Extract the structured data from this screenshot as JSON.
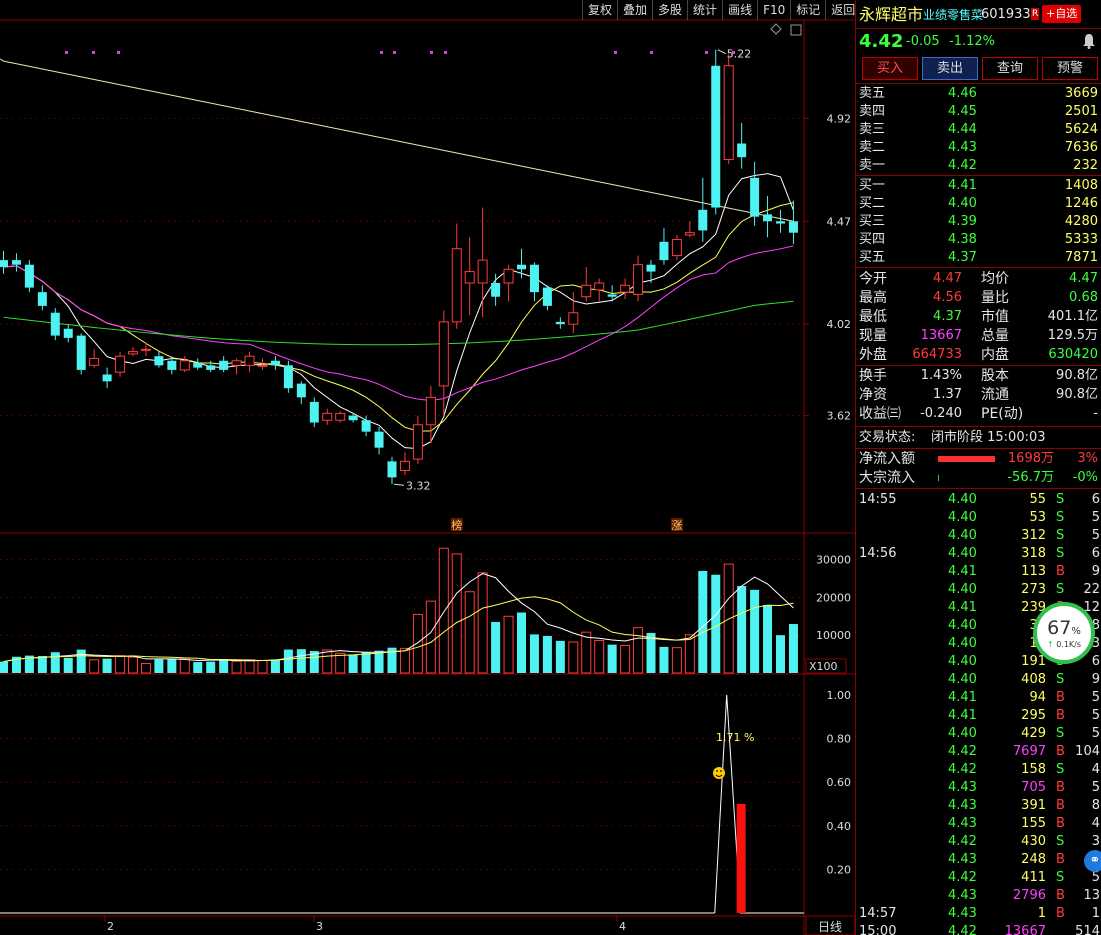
{
  "toolbar": [
    "复权",
    "叠加",
    "多股",
    "统计",
    "画线",
    "F10",
    "标记",
    "返回"
  ],
  "stock": {
    "name": "永辉超市",
    "sector": "业绩零售菜",
    "code": "601933",
    "r_badge": "R",
    "watch_button": "+自选",
    "price": "4.42",
    "change": "-0.05",
    "change_pct": "-1.12%"
  },
  "actions": [
    "买入",
    "卖出",
    "查询",
    "预警"
  ],
  "asks": [
    {
      "label": "卖五",
      "price": "4.46",
      "vol": "3669"
    },
    {
      "label": "卖四",
      "price": "4.45",
      "vol": "2501"
    },
    {
      "label": "卖三",
      "price": "4.44",
      "vol": "5624"
    },
    {
      "label": "卖二",
      "price": "4.43",
      "vol": "7636"
    },
    {
      "label": "卖一",
      "price": "4.42",
      "vol": "232"
    }
  ],
  "bids": [
    {
      "label": "买一",
      "price": "4.41",
      "vol": "1408"
    },
    {
      "label": "买二",
      "price": "4.40",
      "vol": "1246"
    },
    {
      "label": "买三",
      "price": "4.39",
      "vol": "4280"
    },
    {
      "label": "买四",
      "price": "4.38",
      "vol": "5333"
    },
    {
      "label": "买五",
      "price": "4.37",
      "vol": "7871"
    }
  ],
  "stats": [
    {
      "l1": "今开",
      "v1": "4.47",
      "c1": "red",
      "l2": "均价",
      "v2": "4.47",
      "c2": "green"
    },
    {
      "l1": "最高",
      "v1": "4.56",
      "c1": "red",
      "l2": "量比",
      "v2": "0.68",
      "c2": "green"
    },
    {
      "l1": "最低",
      "v1": "4.37",
      "c1": "green",
      "l2": "市值",
      "v2": "401.1亿",
      "c2": "white"
    },
    {
      "l1": "现量",
      "v1": "13667",
      "c1": "magenta",
      "l2": "总量",
      "v2": "129.5万",
      "c2": "white"
    },
    {
      "l1": "外盘",
      "v1": "664733",
      "c1": "red",
      "l2": "内盘",
      "v2": "630420",
      "c2": "green"
    }
  ],
  "stats2": [
    {
      "l1": "换手",
      "v1": "1.43%",
      "l2": "股本",
      "v2": "90.8亿"
    },
    {
      "l1": "净资",
      "v1": "1.37",
      "l2": "流通",
      "v2": "90.8亿"
    },
    {
      "l1": "收益㈢",
      "v1": "-0.240",
      "l2": "PE(动)",
      "v2": "-"
    }
  ],
  "status": {
    "label": "交易状态:",
    "value": "闭市阶段 15:00:03"
  },
  "flows": [
    {
      "label": "净流入额",
      "value": "1698万",
      "pct": "3%",
      "color": "red",
      "bar": 0.6
    },
    {
      "label": "大宗流入",
      "value": "-56.7万",
      "pct": "-0%",
      "color": "green",
      "bar": 0.0
    }
  ],
  "ticks": [
    {
      "time": "14:55",
      "price": "4.40",
      "vol": "55",
      "bs": "S",
      "n": "6",
      "vc": "white"
    },
    {
      "time": "",
      "price": "4.40",
      "vol": "53",
      "bs": "S",
      "n": "5",
      "vc": "white"
    },
    {
      "time": "",
      "price": "4.40",
      "vol": "312",
      "bs": "S",
      "n": "5",
      "vc": "white"
    },
    {
      "time": "14:56",
      "price": "4.40",
      "vol": "318",
      "bs": "S",
      "n": "6",
      "vc": "white"
    },
    {
      "time": "",
      "price": "4.41",
      "vol": "113",
      "bs": "B",
      "n": "9",
      "vc": "white"
    },
    {
      "time": "",
      "price": "4.40",
      "vol": "273",
      "bs": "S",
      "n": "22",
      "vc": "white"
    },
    {
      "time": "",
      "price": "4.41",
      "vol": "239",
      "bs": "B",
      "n": "12",
      "vc": "white"
    },
    {
      "time": "",
      "price": "4.40",
      "vol": "31",
      "bs": "S",
      "n": "8",
      "vc": "white"
    },
    {
      "time": "",
      "price": "4.40",
      "vol": "18",
      "bs": "S",
      "n": "3",
      "vc": "white"
    },
    {
      "time": "",
      "price": "4.40",
      "vol": "191",
      "bs": "S",
      "n": "6",
      "vc": "white"
    },
    {
      "time": "",
      "price": "4.40",
      "vol": "408",
      "bs": "S",
      "n": "9",
      "vc": "white"
    },
    {
      "time": "",
      "price": "4.41",
      "vol": "94",
      "bs": "B",
      "n": "5",
      "vc": "white"
    },
    {
      "time": "",
      "price": "4.41",
      "vol": "295",
      "bs": "B",
      "n": "5",
      "vc": "white"
    },
    {
      "time": "",
      "price": "4.40",
      "vol": "429",
      "bs": "S",
      "n": "5",
      "vc": "white"
    },
    {
      "time": "",
      "price": "4.42",
      "vol": "7697",
      "bs": "B",
      "n": "104",
      "vc": "magenta"
    },
    {
      "time": "",
      "price": "4.42",
      "vol": "158",
      "bs": "S",
      "n": "4",
      "vc": "white"
    },
    {
      "time": "",
      "price": "4.43",
      "vol": "705",
      "bs": "B",
      "n": "5",
      "vc": "magenta"
    },
    {
      "time": "",
      "price": "4.43",
      "vol": "391",
      "bs": "B",
      "n": "8",
      "vc": "white"
    },
    {
      "time": "",
      "price": "4.43",
      "vol": "155",
      "bs": "B",
      "n": "4",
      "vc": "white"
    },
    {
      "time": "",
      "price": "4.42",
      "vol": "430",
      "bs": "S",
      "n": "3",
      "vc": "white"
    },
    {
      "time": "",
      "price": "4.43",
      "vol": "248",
      "bs": "B",
      "n": "6",
      "vc": "white"
    },
    {
      "time": "",
      "price": "4.42",
      "vol": "411",
      "bs": "S",
      "n": "5",
      "vc": "white"
    },
    {
      "time": "",
      "price": "4.43",
      "vol": "2796",
      "bs": "B",
      "n": "13",
      "vc": "magenta"
    },
    {
      "time": "14:57",
      "price": "4.43",
      "vol": "1",
      "bs": "B",
      "n": "1",
      "vc": "white"
    },
    {
      "time": "15:00",
      "price": "4.42",
      "vol": "13667",
      "bs": "",
      "n": "514",
      "vc": "magenta"
    }
  ],
  "speed": {
    "pct": "67",
    "unit": "%",
    "rate": "0.1K/s"
  },
  "chart_data": {
    "type": "candlestick",
    "price_axis": [
      "4.92",
      "4.47",
      "4.02",
      "3.62"
    ],
    "high_label": "5.22",
    "low_label": "3.32",
    "markers": [
      "榜",
      "涨"
    ],
    "volume_axis": [
      "30000",
      "20000",
      "10000"
    ],
    "volume_unit": "X100",
    "indicator_axis": [
      "1.00",
      "0.80",
      "0.60",
      "0.40",
      "0.20"
    ],
    "indicator_label": "1.71 %",
    "x_labels": [
      "2",
      "3",
      "4"
    ],
    "period": "日线",
    "candles": [
      {
        "o": 4.3,
        "c": 4.27,
        "h": 4.34,
        "l": 4.24,
        "v": 3000
      },
      {
        "o": 4.3,
        "c": 4.28,
        "h": 4.33,
        "l": 4.25,
        "v": 4300
      },
      {
        "o": 4.28,
        "c": 4.18,
        "h": 4.3,
        "l": 4.16,
        "v": 4600
      },
      {
        "o": 4.16,
        "c": 4.1,
        "h": 4.19,
        "l": 4.08,
        "v": 4500
      },
      {
        "o": 4.07,
        "c": 3.97,
        "h": 4.09,
        "l": 3.95,
        "v": 5500
      },
      {
        "o": 4.0,
        "c": 3.96,
        "h": 4.02,
        "l": 3.94,
        "v": 4000
      },
      {
        "o": 3.97,
        "c": 3.82,
        "h": 3.98,
        "l": 3.8,
        "v": 6200
      },
      {
        "o": 3.84,
        "c": 3.87,
        "h": 3.91,
        "l": 3.83,
        "v": 3500
      },
      {
        "o": 3.8,
        "c": 3.77,
        "h": 3.83,
        "l": 3.74,
        "v": 3800
      },
      {
        "o": 3.81,
        "c": 3.88,
        "h": 3.9,
        "l": 3.79,
        "v": 4600
      },
      {
        "o": 3.89,
        "c": 3.9,
        "h": 3.92,
        "l": 3.88,
        "v": 4200
      },
      {
        "o": 3.91,
        "c": 3.91,
        "h": 3.94,
        "l": 3.88,
        "v": 2500
      },
      {
        "o": 3.88,
        "c": 3.84,
        "h": 3.9,
        "l": 3.83,
        "v": 3600
      },
      {
        "o": 3.86,
        "c": 3.82,
        "h": 3.88,
        "l": 3.8,
        "v": 3700
      },
      {
        "o": 3.82,
        "c": 3.86,
        "h": 3.88,
        "l": 3.81,
        "v": 3900
      },
      {
        "o": 3.85,
        "c": 3.83,
        "h": 3.87,
        "l": 3.82,
        "v": 2900
      },
      {
        "o": 3.84,
        "c": 3.82,
        "h": 3.86,
        "l": 3.81,
        "v": 3000
      },
      {
        "o": 3.86,
        "c": 3.82,
        "h": 3.88,
        "l": 3.81,
        "v": 3600
      },
      {
        "o": 3.84,
        "c": 3.86,
        "h": 3.87,
        "l": 3.8,
        "v": 3100
      },
      {
        "o": 3.84,
        "c": 3.88,
        "h": 3.9,
        "l": 3.81,
        "v": 3500
      },
      {
        "o": 3.84,
        "c": 3.84,
        "h": 3.87,
        "l": 3.82,
        "v": 3300
      },
      {
        "o": 3.86,
        "c": 3.84,
        "h": 3.88,
        "l": 3.82,
        "v": 3600
      },
      {
        "o": 3.84,
        "c": 3.74,
        "h": 3.86,
        "l": 3.72,
        "v": 6200
      },
      {
        "o": 3.76,
        "c": 3.7,
        "h": 3.77,
        "l": 3.67,
        "v": 6300
      },
      {
        "o": 3.68,
        "c": 3.59,
        "h": 3.7,
        "l": 3.57,
        "v": 5800
      },
      {
        "o": 3.6,
        "c": 3.63,
        "h": 3.65,
        "l": 3.58,
        "v": 6100
      },
      {
        "o": 3.6,
        "c": 3.63,
        "h": 3.64,
        "l": 3.59,
        "v": 5200
      },
      {
        "o": 3.62,
        "c": 3.6,
        "h": 3.63,
        "l": 3.59,
        "v": 4800
      },
      {
        "o": 3.6,
        "c": 3.55,
        "h": 3.62,
        "l": 3.53,
        "v": 5500
      },
      {
        "o": 3.55,
        "c": 3.48,
        "h": 3.57,
        "l": 3.45,
        "v": 5900
      },
      {
        "o": 3.42,
        "c": 3.35,
        "h": 3.44,
        "l": 3.32,
        "v": 6700
      },
      {
        "o": 3.38,
        "c": 3.42,
        "h": 3.46,
        "l": 3.36,
        "v": 6500
      },
      {
        "o": 3.43,
        "c": 3.58,
        "h": 3.62,
        "l": 3.41,
        "v": 15500
      },
      {
        "o": 3.58,
        "c": 3.7,
        "h": 3.75,
        "l": 3.5,
        "v": 19000
      },
      {
        "o": 3.75,
        "c": 4.03,
        "h": 4.08,
        "l": 3.62,
        "v": 33000
      },
      {
        "o": 4.03,
        "c": 4.35,
        "h": 4.46,
        "l": 4.0,
        "v": 31500
      },
      {
        "o": 4.2,
        "c": 4.25,
        "h": 4.4,
        "l": 4.06,
        "v": 21500
      },
      {
        "o": 4.2,
        "c": 4.3,
        "h": 4.53,
        "l": 4.05,
        "v": 26500
      },
      {
        "o": 4.2,
        "c": 4.14,
        "h": 4.24,
        "l": 4.1,
        "v": 13500
      },
      {
        "o": 4.2,
        "c": 4.26,
        "h": 4.28,
        "l": 4.12,
        "v": 15000
      },
      {
        "o": 4.28,
        "c": 4.26,
        "h": 4.35,
        "l": 4.22,
        "v": 16000
      },
      {
        "o": 4.28,
        "c": 4.16,
        "h": 4.29,
        "l": 4.12,
        "v": 10200
      },
      {
        "o": 4.18,
        "c": 4.1,
        "h": 4.19,
        "l": 4.08,
        "v": 9800
      },
      {
        "o": 4.03,
        "c": 4.02,
        "h": 4.05,
        "l": 4.0,
        "v": 8500
      },
      {
        "o": 4.02,
        "c": 4.07,
        "h": 4.16,
        "l": 3.98,
        "v": 8200
      },
      {
        "o": 4.14,
        "c": 4.19,
        "h": 4.27,
        "l": 4.12,
        "v": 10800
      },
      {
        "o": 4.17,
        "c": 4.2,
        "h": 4.22,
        "l": 4.12,
        "v": 8600
      },
      {
        "o": 4.15,
        "c": 4.14,
        "h": 4.19,
        "l": 4.12,
        "v": 7500
      },
      {
        "o": 4.16,
        "c": 4.19,
        "h": 4.22,
        "l": 4.13,
        "v": 7300
      },
      {
        "o": 4.15,
        "c": 4.28,
        "h": 4.32,
        "l": 4.12,
        "v": 12000
      },
      {
        "o": 4.28,
        "c": 4.25,
        "h": 4.3,
        "l": 4.2,
        "v": 10600
      },
      {
        "o": 4.38,
        "c": 4.3,
        "h": 4.44,
        "l": 4.28,
        "v": 6900
      },
      {
        "o": 4.32,
        "c": 4.39,
        "h": 4.41,
        "l": 4.3,
        "v": 6700
      },
      {
        "o": 4.41,
        "c": 4.42,
        "h": 4.47,
        "l": 4.4,
        "v": 10100
      },
      {
        "o": 4.52,
        "c": 4.43,
        "h": 4.66,
        "l": 4.38,
        "v": 27000
      },
      {
        "o": 5.15,
        "c": 4.53,
        "h": 5.22,
        "l": 4.5,
        "v": 26000
      },
      {
        "o": 4.74,
        "c": 5.15,
        "h": 5.2,
        "l": 4.72,
        "v": 28800
      },
      {
        "o": 4.81,
        "c": 4.75,
        "h": 4.9,
        "l": 4.7,
        "v": 23000
      },
      {
        "o": 4.66,
        "c": 4.49,
        "h": 4.73,
        "l": 4.45,
        "v": 22000
      },
      {
        "o": 4.5,
        "c": 4.47,
        "h": 4.58,
        "l": 4.4,
        "v": 18000
      },
      {
        "o": 4.47,
        "c": 4.46,
        "h": 4.52,
        "l": 4.42,
        "v": 10000
      },
      {
        "o": 4.47,
        "c": 4.42,
        "h": 4.56,
        "l": 4.37,
        "v": 12950
      }
    ],
    "ma_series": [
      {
        "name": "MA5",
        "color": "#ffffff"
      },
      {
        "name": "MA10",
        "color": "#ffff55"
      },
      {
        "name": "MA20",
        "color": "#ff40ff"
      },
      {
        "name": "MA60",
        "color": "#33dd33"
      },
      {
        "name": "MA250",
        "color": "#e8e8b0"
      }
    ]
  }
}
